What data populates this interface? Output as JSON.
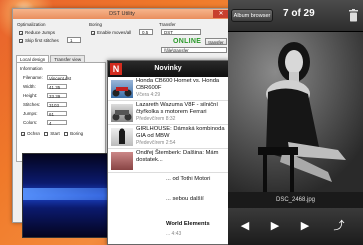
{
  "dst": {
    "title": "DST Utility",
    "optimalization_label": "Optimalization",
    "reduce_jumps": "Reduce Jumps",
    "skip_first_stitches": "Skip first stitches",
    "skip_value": "1",
    "boring_label": "Boring",
    "enable_moves_label": "Enable moves/all",
    "boring_value": "0.5",
    "transfer_label": "Transfer",
    "transfer_input": "DST",
    "online_status": "ONLINE",
    "transfer_button": "transfer",
    "folder_field": "\\\\file\\transfer",
    "tabs": [
      "Local design",
      "Transfer view"
    ],
    "information_label": "Information",
    "filename_label": "Filename:",
    "filename_value": "Vincent.dst",
    "width_label": "Width:",
    "width_value": "41.35",
    "height_label": "Height:",
    "height_value": "33.39",
    "stitches_label": "Stitches:",
    "stitches_value": "3103",
    "jumps_label": "Jumps:",
    "jumps_value": "61",
    "colors_label": "Colors:",
    "colors_value": "4",
    "checks": [
      "Ochsn",
      "Start",
      "Boring"
    ]
  },
  "novinky": {
    "title": "Novinky",
    "logo": "N",
    "items": [
      {
        "title": "Honda CB600 Hornet vs. Honda CBR600F",
        "time": "Včera 4:29"
      },
      {
        "title": "Lazareth Wazuma V8F - silniční čtyřkolka s motorem Ferrari",
        "time": "Předevčírem 8:32"
      },
      {
        "title": "GIRLHOUSE: Dámská kombinoda GIA od MBW",
        "time": "Předevčírem 2:54"
      },
      {
        "title": "Ondřej Štemberk: Dalšina: Mám dostatek...",
        "time": ""
      }
    ],
    "extra_text_1": "... od Tothi Motori",
    "extra_text_2": "... sebou dalšíí",
    "extra_text_3": "World Elements",
    "extra_time_3": "... 4:43"
  },
  "phone": {
    "album_button": "Album browser",
    "counter": "7 of 29",
    "caption": "DSC_2468.jpg"
  },
  "colors": {
    "accent_online": "#2a9a2a",
    "novinky_red": "#d42c1e"
  }
}
